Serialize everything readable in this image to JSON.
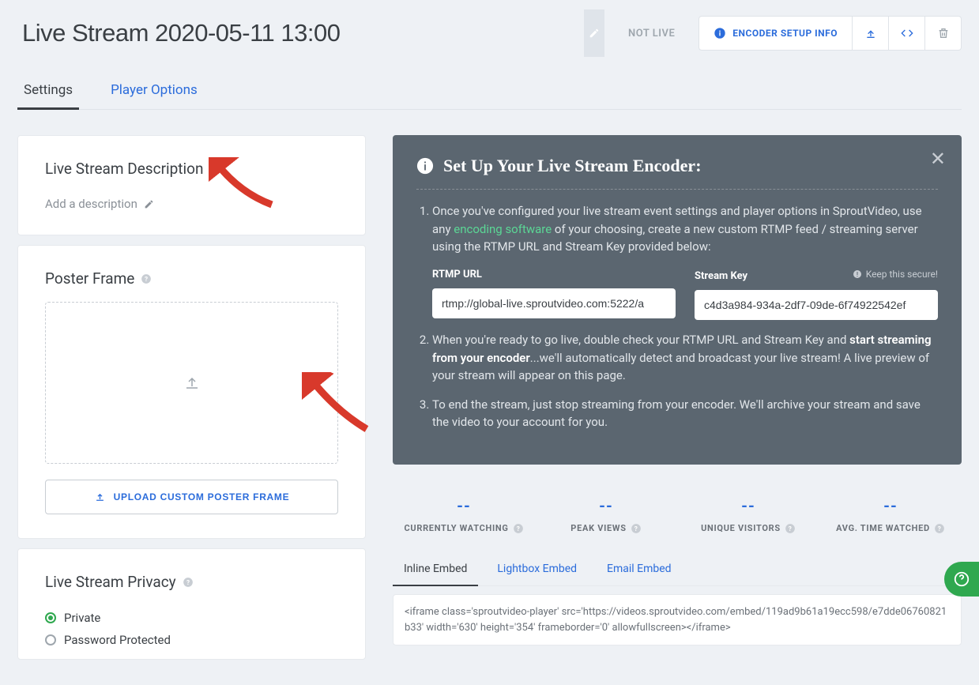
{
  "header": {
    "title": "Live Stream 2020-05-11 13:00",
    "status": "NOT LIVE",
    "encoder_btn": "ENCODER SETUP INFO"
  },
  "tabs": {
    "settings": "Settings",
    "player_options": "Player Options"
  },
  "description": {
    "title": "Live Stream Description",
    "placeholder": "Add a description"
  },
  "poster": {
    "title": "Poster Frame",
    "upload_btn": "UPLOAD CUSTOM POSTER FRAME"
  },
  "privacy": {
    "title": "Live Stream Privacy",
    "options": [
      "Private",
      "Password Protected"
    ]
  },
  "setup": {
    "title": "Set Up Your Live Stream Encoder:",
    "step1_a": "Once you've configured your live stream event settings and player options in SproutVideo, use any ",
    "step1_link": "encoding software",
    "step1_b": " of your choosing, create a new custom RTMP feed / streaming server using the RTMP URL and Stream Key provided below:",
    "rtmp_label": "RTMP URL",
    "rtmp_value": "rtmp://global-live.sproutvideo.com:5222/a",
    "key_label": "Stream Key",
    "key_hint": "Keep this secure!",
    "key_value": "c4d3a984-934a-2df7-09de-6f74922542ef",
    "step2_a": "When you're ready to go live, double check your RTMP URL and Stream Key and ",
    "step2_strong": "start streaming from your encoder",
    "step2_b": "...we'll automatically detect and broadcast your live stream! A live preview of your stream will appear on this page.",
    "step3": "To end the stream, just stop streaming from your encoder. We'll archive your stream and save the video to your account for you."
  },
  "stats": {
    "placeholder": "--",
    "labels": [
      "CURRENTLY WATCHING",
      "PEAK VIEWS",
      "UNIQUE VISITORS",
      "AVG. TIME WATCHED"
    ]
  },
  "embed": {
    "tabs": [
      "Inline Embed",
      "Lightbox Embed",
      "Email Embed"
    ],
    "code": "<iframe class='sproutvideo-player' src='https://videos.sproutvideo.com/embed/119ad9b61a19ecc598/e7dde06760821b33' width='630' height='354' frameborder='0' allowfullscreen></iframe>"
  }
}
